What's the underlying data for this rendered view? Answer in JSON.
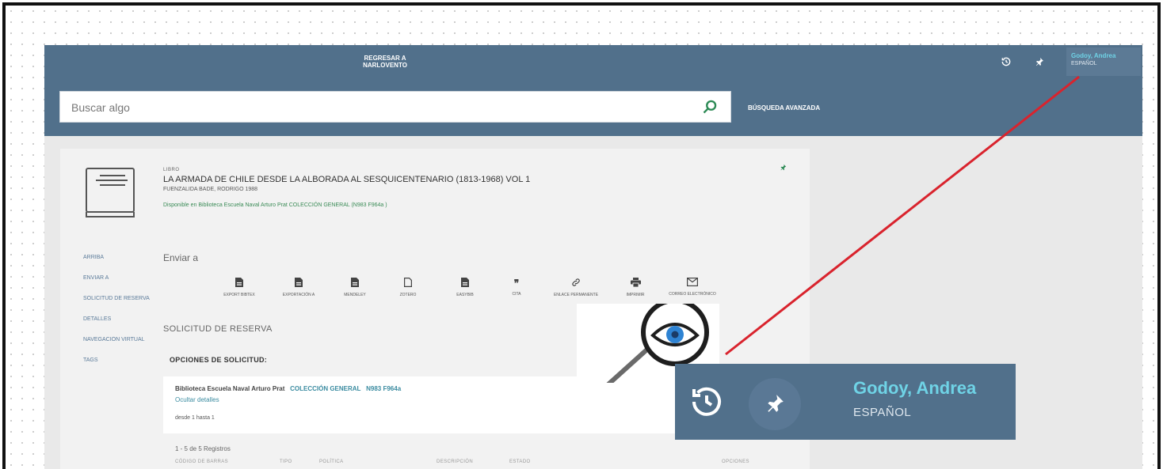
{
  "topbar": {
    "back_link": "REGRESAR A NARLOVENTO",
    "user_name": "Godoy, Andrea",
    "language": "ESPAÑOL",
    "icons": [
      "history-icon",
      "pin-icon"
    ]
  },
  "search": {
    "placeholder": "Buscar algo",
    "advanced_label": "BÚSQUEDA AVANZADA"
  },
  "record": {
    "type": "LIBRO",
    "title": "LA ARMADA DE CHILE DESDE LA ALBORADA AL SESQUICENTENARIO (1813-1968) VOL 1",
    "author": "FUENZALIDA BADE, RODRIGO 1988",
    "availability": "Disponible en Biblioteca Escuela Naval Arturo Prat  COLECCIÓN GENERAL (N983 F964a )"
  },
  "sidenav": [
    "ARRIBA",
    "ENVIAR A",
    "SOLICITUD DE RESERVA",
    "DETALLES",
    "NAVEGACIÓN VIRTUAL",
    "TAGS"
  ],
  "send_to": {
    "heading": "Enviar a",
    "actions": [
      {
        "label": "EXPORT BIBTEX",
        "icon": "file-icon"
      },
      {
        "label": "EXPORTACIÓN A",
        "icon": "file-icon"
      },
      {
        "label": "MENDELEY",
        "icon": "file-icon"
      },
      {
        "label": "ZOTERO",
        "icon": "document-icon"
      },
      {
        "label": "EASYBIB",
        "icon": "file-icon"
      },
      {
        "label": "CITA",
        "icon": "quote-icon"
      },
      {
        "label": "ENLACE PERMANENTE",
        "icon": "link-icon"
      },
      {
        "label": "IMPRIMIR",
        "icon": "print-icon"
      },
      {
        "label": "CORREO ELECTRÓNICO",
        "icon": "mail-icon"
      }
    ]
  },
  "reservation": {
    "heading": "SOLICITUD DE RESERVA",
    "options_heading": "OPCIONES DE SOLICITUD:",
    "library": "Biblioteca Escuela Naval Arturo Prat",
    "collection": "COLECCIÓN GENERAL",
    "call_number": "N983 F964a",
    "hide_details": "Ocultar detalles",
    "range": "desde 1 hasta 1",
    "records": "1 - 5 de 5 Registros",
    "columns": [
      "CÓDIGO DE BARRAS",
      "TIPO",
      "POLÍTICA",
      "DESCRIPCIÓN",
      "ESTADO",
      "OPCIONES"
    ]
  },
  "colors": {
    "header": "#51708b",
    "accent_cyan": "#6fd3e6",
    "annotation_red": "#d9232d"
  }
}
